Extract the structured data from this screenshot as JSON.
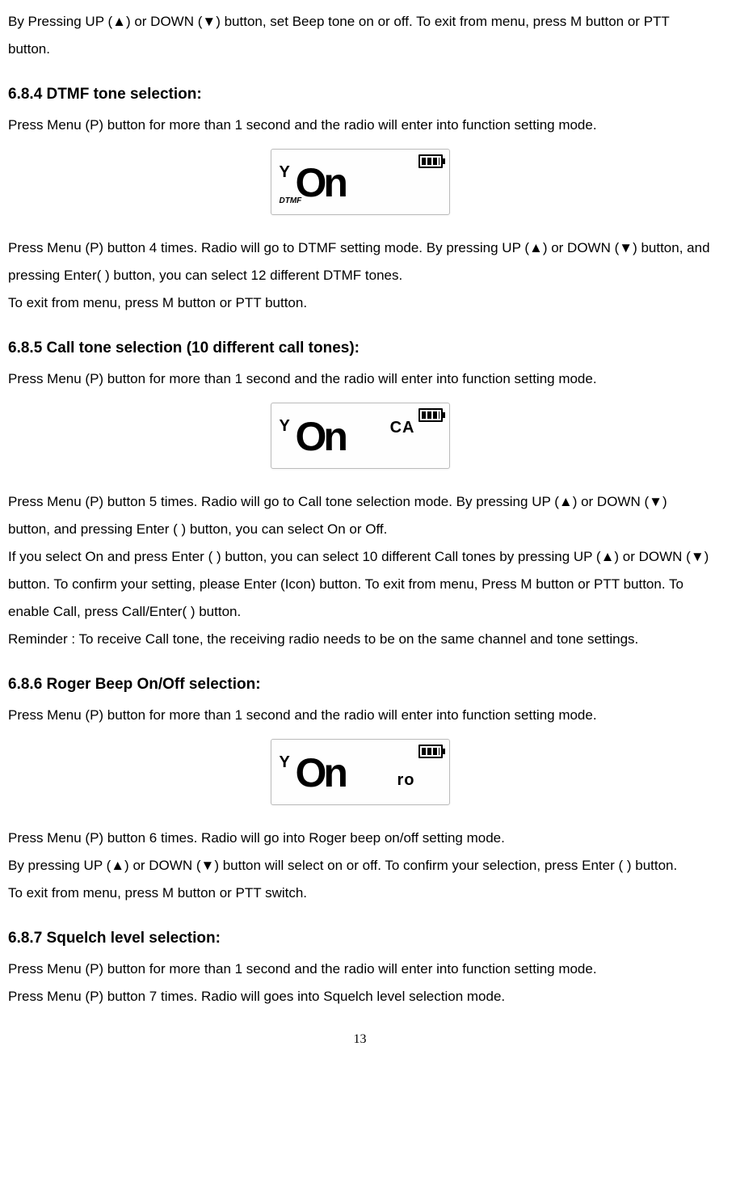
{
  "intro_para": "By Pressing UP (▲) or DOWN (▼) button, set Beep tone on or off. To exit from menu, press M button or PTT button.",
  "sections": {
    "s684": {
      "heading": "6.8.4 DTMF tone selection:",
      "p1": "Press Menu (P) button for more than 1 second and the radio will enter into function setting mode.",
      "lcd": {
        "main": "On",
        "sub_left": "DTMF",
        "sub_right": ""
      },
      "p2": "Press Menu (P) button 4 times. Radio will go to DTMF setting mode. By pressing UP (▲) or DOWN (▼) button, and pressing Enter( ) button, you can select 12 different DTMF tones.",
      "p3": "To exit from menu, press M button or PTT button."
    },
    "s685": {
      "heading": "6.8.5 Call tone selection (10 different call tones):",
      "p1": "Press Menu (P) button for more than 1 second and the radio will enter into function setting mode.",
      "lcd": {
        "main": "On",
        "sub_left": "",
        "sub_right": "CA"
      },
      "p2": "Press Menu (P) button 5 times. Radio will go to Call tone selection mode. By pressing UP (▲) or DOWN (▼) button, and pressing Enter ( ) button, you can select On or Off.",
      "p3": "If you select On and press Enter ( ) button, you can select 10 different Call tones by pressing UP (▲) or DOWN (▼) button. To confirm your setting, please Enter (Icon) button. To exit from menu, Press M button or PTT button. To enable Call, press Call/Enter( ) button.",
      "p4": "  Reminder : To receive Call tone, the receiving radio needs to be on the same channel and tone settings."
    },
    "s686": {
      "heading": "6.8.6 Roger Beep On/Off selection:",
      "p1": "Press Menu (P) button for more than 1 second and the radio will enter into function setting mode.",
      "lcd": {
        "main": "On",
        "sub_left": "",
        "sub_right": "ro"
      },
      "p2": "Press Menu (P) button 6 times. Radio will go into Roger beep on/off setting mode.",
      "p3": "By pressing UP (▲) or DOWN (▼) button will select on or off. To confirm your selection, press Enter ( ) button.",
      "p4": "To exit from menu, press M button or PTT switch."
    },
    "s687": {
      "heading": "6.8.7 Squelch level selection:",
      "p1": "Press Menu (P) button for more than 1 second and the radio will enter into function setting mode.",
      "p2": "Press Menu (P) button 7 times. Radio will goes into Squelch level selection mode."
    }
  },
  "page_number": "13"
}
